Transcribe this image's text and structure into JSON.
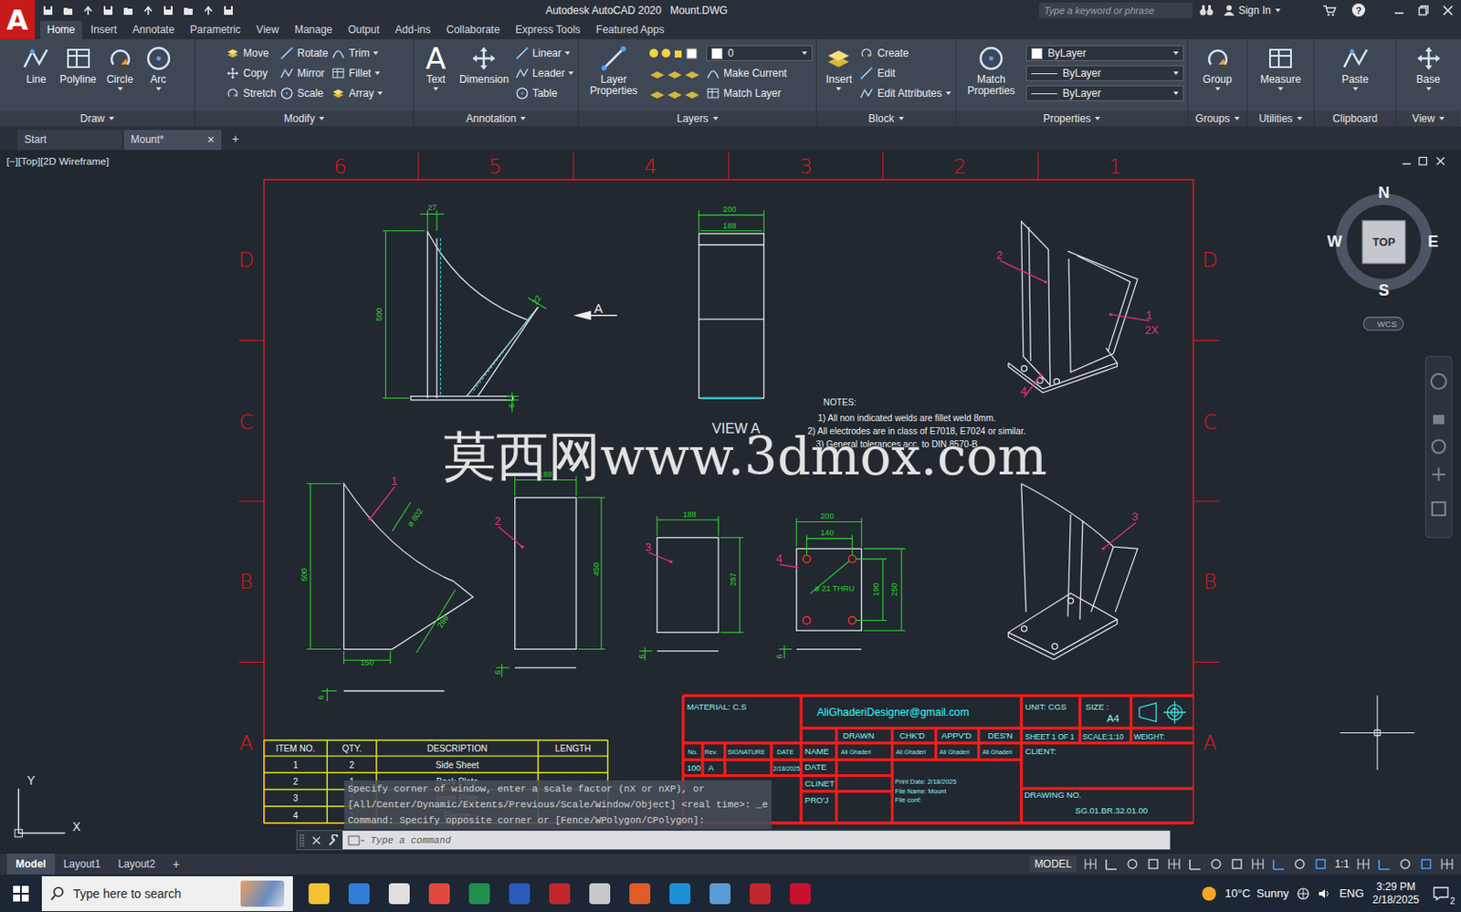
{
  "window": {
    "app_logo": "A",
    "title": "Autodesk AutoCAD 2020",
    "file": "Mount.DWG",
    "search_placeholder": "Type a keyword or phrase",
    "sign_in": "Sign In",
    "help": "?"
  },
  "menu_tabs": [
    {
      "label": "Home",
      "selected": true
    },
    {
      "label": "Insert",
      "selected": false
    },
    {
      "label": "Annotate",
      "selected": false
    },
    {
      "label": "Parametric",
      "selected": false
    },
    {
      "label": "View",
      "selected": false
    },
    {
      "label": "Manage",
      "selected": false
    },
    {
      "label": "Output",
      "selected": false
    },
    {
      "label": "Add-ins",
      "selected": false
    },
    {
      "label": "Collaborate",
      "selected": false
    },
    {
      "label": "Express Tools",
      "selected": false
    },
    {
      "label": "Featured Apps",
      "selected": false
    }
  ],
  "ribbon": [
    {
      "title": "Draw",
      "caret": true,
      "columns": [
        {
          "kind": "large",
          "label": "Line",
          "caret": false
        },
        {
          "kind": "large",
          "label": "Polyline",
          "caret": false
        },
        {
          "kind": "large",
          "label": "Circle",
          "caret": true
        },
        {
          "kind": "large",
          "label": "Arc",
          "caret": true
        }
      ]
    },
    {
      "title": "Modify",
      "caret": true,
      "columns": [
        {
          "kind": "stack",
          "items": [
            {
              "label": "Move",
              "caret": false,
              "field": false
            },
            {
              "label": "Copy",
              "caret": false,
              "field": false
            },
            {
              "label": "Stretch",
              "caret": false,
              "field": false
            }
          ]
        },
        {
          "kind": "stack",
          "items": [
            {
              "label": "Rotate",
              "caret": false,
              "field": false
            },
            {
              "label": "Mirror",
              "caret": false,
              "field": false
            },
            {
              "label": "Scale",
              "caret": false,
              "field": false
            }
          ]
        },
        {
          "kind": "stack",
          "items": [
            {
              "label": "Trim",
              "caret": true,
              "field": false
            },
            {
              "label": "Fillet",
              "caret": true,
              "field": false
            },
            {
              "label": "Array",
              "caret": true,
              "field": false
            }
          ]
        }
      ]
    },
    {
      "title": "Annotation",
      "caret": true,
      "columns": [
        {
          "kind": "large",
          "label": "Text",
          "glyph": "A",
          "caret": true
        },
        {
          "kind": "large",
          "label": "Dimension",
          "caret": false
        },
        {
          "kind": "stack",
          "items": [
            {
              "label": "Linear",
              "caret": true,
              "field": false
            },
            {
              "label": "Leader",
              "caret": true,
              "field": false
            },
            {
              "label": "Table",
              "caret": false,
              "field": false
            }
          ]
        }
      ]
    },
    {
      "title": "Layers",
      "caret": true,
      "columns": [
        {
          "kind": "large",
          "label": "Layer Properties",
          "caret": false
        },
        {
          "kind": "stack",
          "items": [
            {
              "label": "0",
              "caret": true,
              "field": true
            },
            {
              "label": "Make Current",
              "caret": false,
              "field": false
            },
            {
              "label": "Match Layer",
              "caret": false,
              "field": false
            }
          ]
        }
      ]
    },
    {
      "title": "Block",
      "caret": true,
      "columns": [
        {
          "kind": "large",
          "label": "Insert",
          "caret": true
        },
        {
          "kind": "stack",
          "items": [
            {
              "label": "Create",
              "caret": false,
              "field": false
            },
            {
              "label": "Edit",
              "caret": false,
              "field": false
            },
            {
              "label": "Edit Attributes",
              "caret": true,
              "field": false
            }
          ]
        }
      ]
    },
    {
      "title": "Properties",
      "caret": true,
      "columns": [
        {
          "kind": "large",
          "label": "Match Properties",
          "caret": false
        },
        {
          "kind": "stack",
          "items": [
            {
              "label": "ByLayer",
              "caret": true,
              "field": true
            },
            {
              "label": "ByLayer",
              "caret": true,
              "field": true
            },
            {
              "label": "ByLayer",
              "caret": true,
              "field": true
            }
          ]
        }
      ]
    },
    {
      "title": "Groups",
      "caret": true,
      "columns": [
        {
          "kind": "large",
          "label": "Group",
          "caret": true
        }
      ]
    },
    {
      "title": "Utilities",
      "caret": true,
      "columns": [
        {
          "kind": "large",
          "label": "Measure",
          "caret": true
        }
      ]
    },
    {
      "title": "Clipboard",
      "caret": false,
      "columns": [
        {
          "kind": "large",
          "label": "Paste",
          "caret": true
        }
      ]
    },
    {
      "title": "View",
      "caret": true,
      "columns": [
        {
          "kind": "large",
          "label": "Base",
          "caret": true
        }
      ]
    }
  ],
  "doc_tabs": [
    {
      "label": "Start",
      "selected": false,
      "closable": false
    },
    {
      "label": "Mount*",
      "selected": true,
      "closable": true
    }
  ],
  "close_glyph": "×",
  "new_tab": "+",
  "viewport": {
    "label": "[−][Top][2D Wireframe]"
  },
  "viewcube": {
    "north": "N",
    "south": "S",
    "east": "E",
    "west": "W",
    "face": "TOP",
    "ucs": "WCS"
  },
  "ucs_icon": {
    "x": "X",
    "y": "Y"
  },
  "sheet": {
    "zone_columns": [
      "6",
      "5",
      "4",
      "3",
      "2",
      "1"
    ],
    "zone_rows": [
      "D",
      "C",
      "B",
      "A"
    ],
    "dimensions": [
      "27",
      "500",
      "22",
      "6",
      "200",
      "188",
      "ø 802",
      "500",
      "266",
      "150",
      "6",
      "188",
      "450",
      "6",
      "188",
      "287",
      "6",
      "200",
      "140",
      "ø 21 THRU",
      "190",
      "250",
      "6"
    ],
    "balloons": [
      "2",
      "1",
      "2X",
      "4",
      "1",
      "2",
      "3",
      "4",
      "3"
    ],
    "section_mark": "A",
    "view_label": "VIEW A",
    "notes": [
      "NOTES:",
      "1) All non indicated welds are fillet weld 8mm.",
      "2) All electrodes are in class of E7018, E7024 or similar.",
      "3) General tolerances acc. to DIN 8570-B"
    ],
    "watermark": "莫西网www.3dmox.com"
  },
  "bom": {
    "columns": [
      "ITEM NO.",
      "QTY.",
      "DESCRIPTION",
      "LENGTH"
    ],
    "rows": [
      [
        "1",
        "2",
        "Side Sheet",
        ""
      ],
      [
        "2",
        "1",
        "Back Plate",
        ""
      ],
      [
        "3",
        "1",
        "Inner Plate",
        ""
      ],
      [
        "4",
        "1",
        "Flange",
        ""
      ]
    ]
  },
  "title_block": [
    "MATERIAL: C.S",
    "AliGhaderiDesigner@gmail.com",
    "UNIT: CGS",
    "SIZE :",
    "A4",
    "DRAWN",
    "CHK'D",
    "APPV'D",
    "DES'N",
    "SHEET 1 OF 1",
    "SCALE:1:10",
    "WEIGHT:",
    "No.",
    "Rev.",
    "SIGNATURE",
    "DATE",
    "NAME",
    "Ali Ghaderi",
    "Ali Ghaderi",
    "Ali Ghaderi",
    "Ali Ghaderi",
    "CLIENT:",
    "100",
    "A",
    "2/18/2025",
    "DATE",
    "CLINET",
    "PRO'J",
    "Print Date: 2/18/2025",
    "File Name: Mount",
    "File conf:",
    "DRAWING NO.",
    "SG.01.BR.32.01.00"
  ],
  "command_line": {
    "history": [
      "Specify corner of window, enter a scale factor (nX or nXP), or",
      "[All/Center/Dynamic/Extents/Previous/Scale/Window/Object] <real time>: _e",
      "Command: Specify opposite corner or [Fence/WPolygon/CPolygon]:"
    ],
    "placeholder": "Type a command"
  },
  "status": {
    "layouts": [
      {
        "label": "Model",
        "selected": true
      },
      {
        "label": "Layout1",
        "selected": false
      },
      {
        "label": "Layout2",
        "selected": false
      }
    ],
    "add": "+",
    "space": "MODEL",
    "scale": "1:1"
  },
  "taskbar": {
    "search_placeholder": "Type here to search",
    "temperature": "10°C",
    "weather": "Sunny",
    "language": "ENG",
    "time": "3:29 PM",
    "date": "2/18/2025",
    "notifications": "2"
  }
}
